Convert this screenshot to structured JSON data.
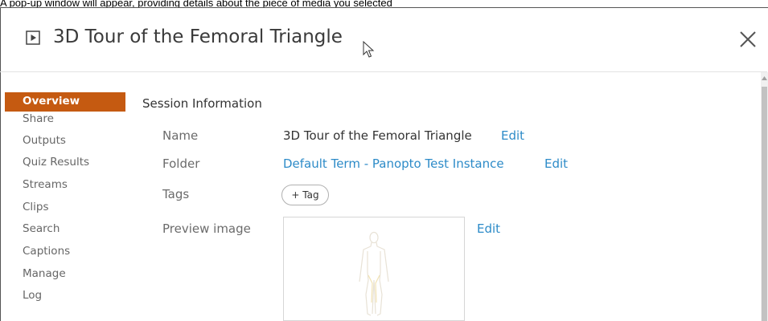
{
  "caption": "A pop-up window will appear, providing details about the piece of media you selected",
  "window": {
    "title": "3D Tour of the Femoral Triangle",
    "icons": {
      "title_icon": "play-icon",
      "close": "close-icon",
      "cursor": "mouse-pointer-icon"
    }
  },
  "sidebar": {
    "items": [
      {
        "label": "Overview",
        "active": true
      },
      {
        "label": "Share"
      },
      {
        "label": "Outputs"
      },
      {
        "label": "Quiz Results"
      },
      {
        "label": "Streams"
      },
      {
        "label": "Clips"
      },
      {
        "label": "Search"
      },
      {
        "label": "Captions"
      },
      {
        "label": "Manage"
      },
      {
        "label": "Log"
      }
    ]
  },
  "session": {
    "section_title": "Session Information",
    "name_label": "Name",
    "name_value": "3D Tour of the Femoral Triangle",
    "name_edit": "Edit",
    "folder_label": "Folder",
    "folder_value": "Default Term - Panopto Test Instance",
    "folder_edit": "Edit",
    "tags_label": "Tags",
    "add_tag": "+ Tag",
    "preview_label": "Preview image",
    "preview_edit": "Edit"
  },
  "colors": {
    "accent": "#c55a11",
    "link": "#2d8bc8",
    "label": "#6b6b6b"
  }
}
